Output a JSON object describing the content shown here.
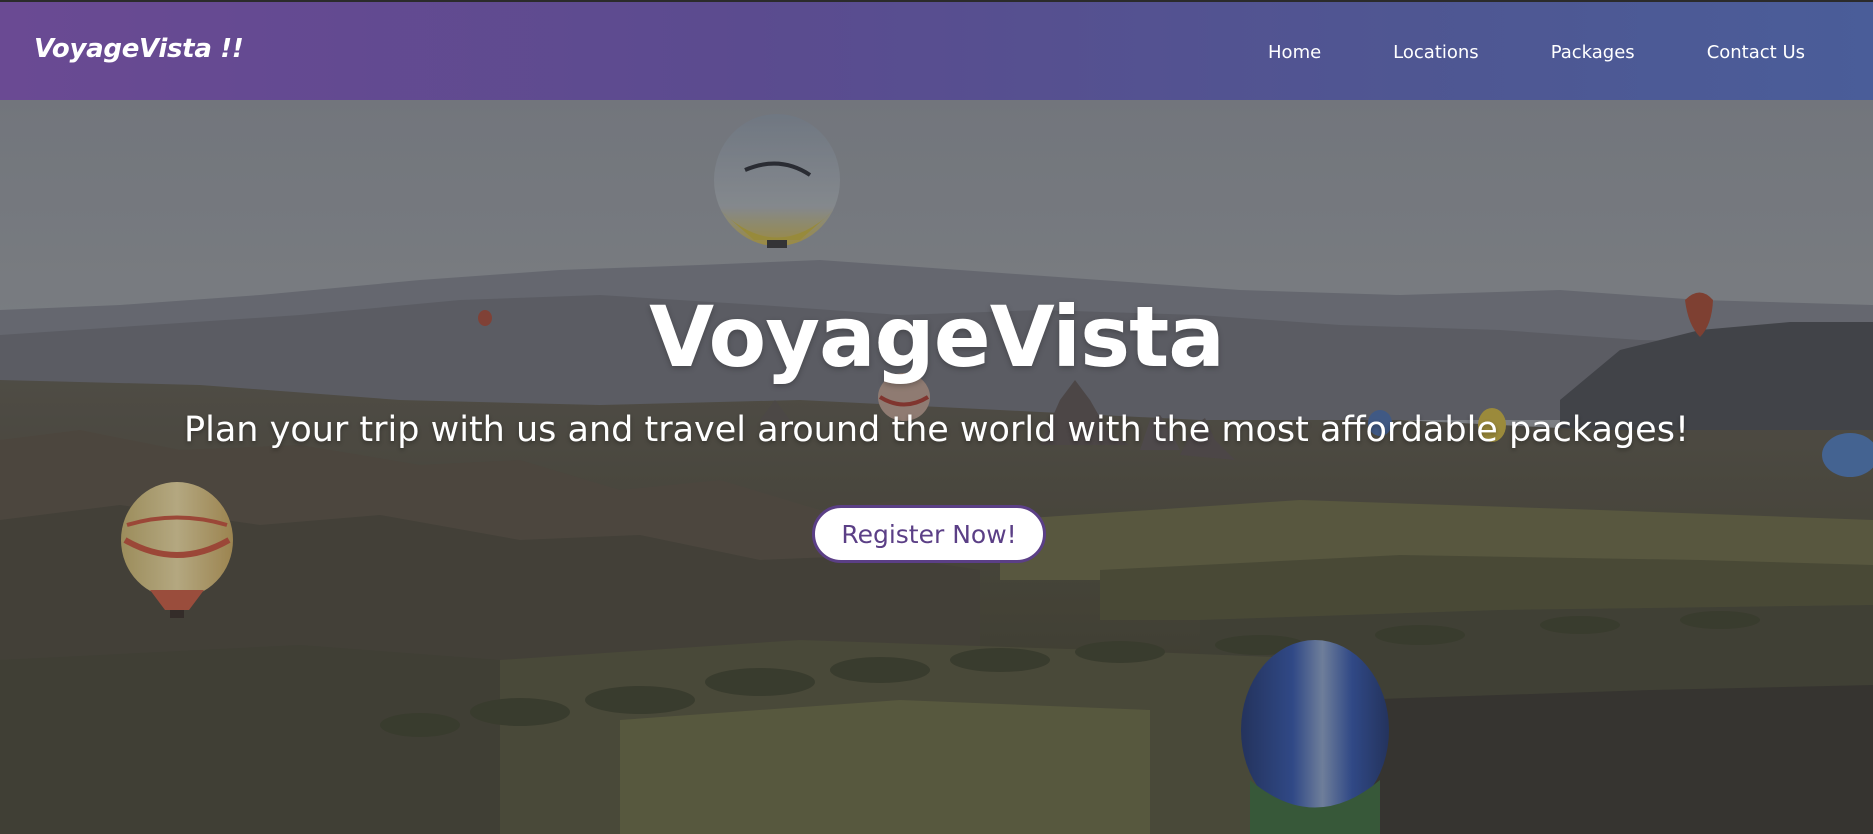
{
  "navbar": {
    "brand": "VoyageVista !!",
    "links": [
      {
        "label": "Home"
      },
      {
        "label": "Locations"
      },
      {
        "label": "Packages"
      },
      {
        "label": "Contact Us"
      }
    ]
  },
  "hero": {
    "title": "VoyageVista",
    "subtitle": "Plan your trip with us and travel around the world with the most affordable packages!",
    "cta_label": "Register Now!"
  },
  "colors": {
    "nav_gradient_start": "#6a4a93",
    "nav_gradient_end": "#4a5d99",
    "button_accent": "#5b3f86",
    "text_light": "#ffffff"
  }
}
